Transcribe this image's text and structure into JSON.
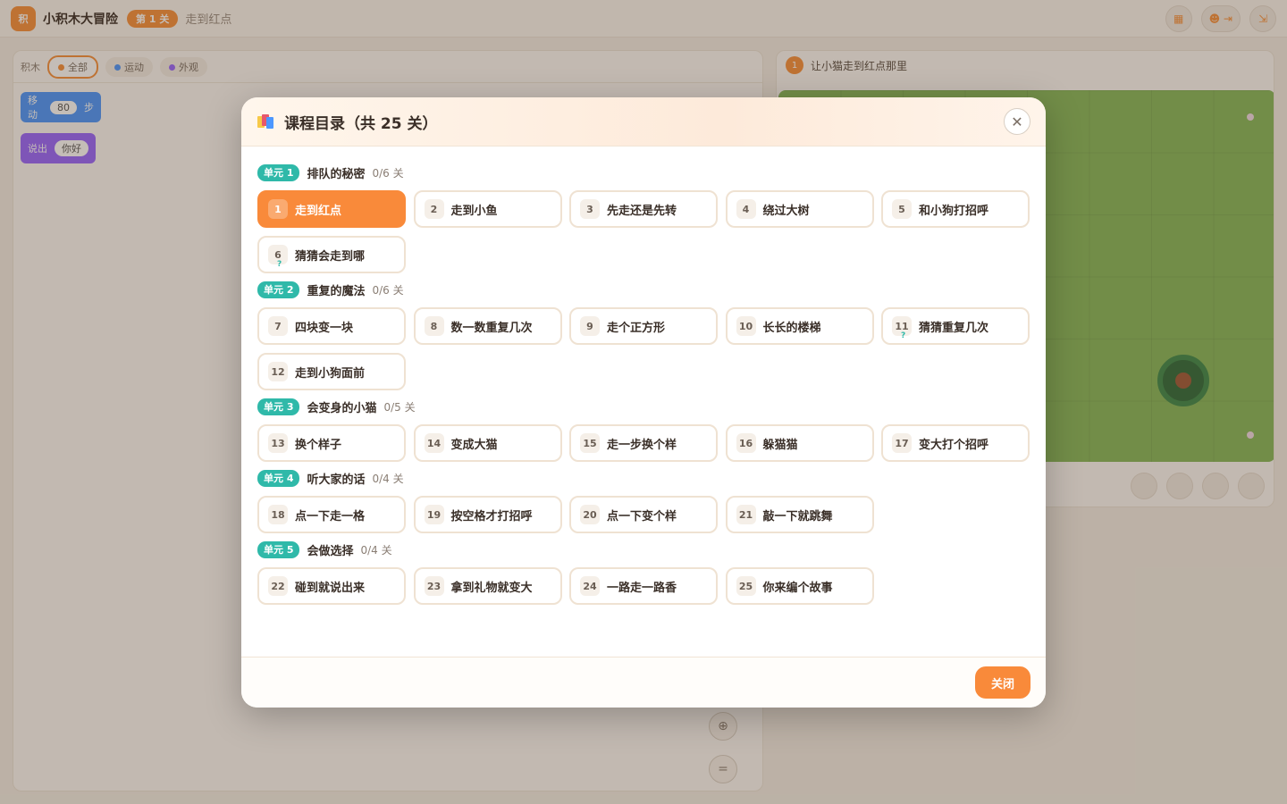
{
  "app": {
    "title": "小积木大冒险",
    "level_badge": "第 1 关",
    "level_name": "走到红点",
    "logo_text": "积"
  },
  "palette": {
    "filter_label": "积木",
    "filters": [
      {
        "label": "全部",
        "color": "#f7913d"
      },
      {
        "label": "运动",
        "color": "#4c97ff"
      },
      {
        "label": "外观",
        "color": "#9966ff"
      }
    ],
    "blocks": [
      {
        "label": "移动",
        "value": "80",
        "suffix": "步",
        "color": "#4c97ff"
      },
      {
        "label": "说出",
        "value": "你好",
        "suffix": "",
        "color": "#9966ff"
      }
    ]
  },
  "stage": {
    "task_number": "1",
    "task_title": "让小猫走到红点那里"
  },
  "catalog": {
    "title": "课程目录（共 25 关）",
    "close_label": "关闭",
    "units": [
      {
        "tag": "单元 1",
        "name": "排队的秘密",
        "progress": "0/6 关",
        "lessons": [
          {
            "num": "1",
            "name": "走到红点",
            "active": true
          },
          {
            "num": "2",
            "name": "走到小鱼"
          },
          {
            "num": "3",
            "name": "先走还是先转"
          },
          {
            "num": "4",
            "name": "绕过大树"
          },
          {
            "num": "5",
            "name": "和小狗打招呼"
          },
          {
            "num": "6",
            "name": "猜猜会走到哪",
            "quiz": "?"
          }
        ]
      },
      {
        "tag": "单元 2",
        "name": "重复的魔法",
        "progress": "0/6 关",
        "lessons": [
          {
            "num": "7",
            "name": "四块变一块"
          },
          {
            "num": "8",
            "name": "数一数重复几次"
          },
          {
            "num": "9",
            "name": "走个正方形"
          },
          {
            "num": "10",
            "name": "长长的楼梯"
          },
          {
            "num": "11",
            "name": "猜猜重复几次",
            "quiz": "?"
          },
          {
            "num": "12",
            "name": "走到小狗面前"
          }
        ]
      },
      {
        "tag": "单元 3",
        "name": "会变身的小猫",
        "progress": "0/5 关",
        "lessons": [
          {
            "num": "13",
            "name": "换个样子"
          },
          {
            "num": "14",
            "name": "变成大猫"
          },
          {
            "num": "15",
            "name": "走一步换个样"
          },
          {
            "num": "16",
            "name": "躲猫猫"
          },
          {
            "num": "17",
            "name": "变大打个招呼"
          }
        ]
      },
      {
        "tag": "单元 4",
        "name": "听大家的话",
        "progress": "0/4 关",
        "lessons": [
          {
            "num": "18",
            "name": "点一下走一格"
          },
          {
            "num": "19",
            "name": "按空格才打招呼"
          },
          {
            "num": "20",
            "name": "点一下变个样"
          },
          {
            "num": "21",
            "name": "敲一下就跳舞"
          }
        ]
      },
      {
        "tag": "单元 5",
        "name": "会做选择",
        "progress": "0/4 关",
        "lessons": [
          {
            "num": "22",
            "name": "碰到就说出来"
          },
          {
            "num": "23",
            "name": "拿到礼物就变大"
          },
          {
            "num": "24",
            "name": "一路走一路香"
          },
          {
            "num": "25",
            "name": "你来编个故事"
          }
        ]
      }
    ]
  },
  "colors": {
    "accent": "#f98a3a",
    "unit_tag": "#2fb9a9",
    "stage_grass": "#86b85c"
  }
}
